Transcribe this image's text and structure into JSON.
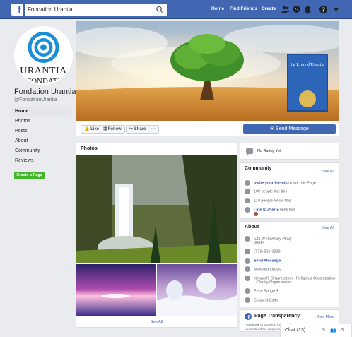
{
  "topbar": {
    "search_value": "Fondation Urantia",
    "nav": [
      "Home",
      "Find Friends",
      "Create"
    ],
    "icons": [
      "friends-icon",
      "messenger-icon",
      "notifications-icon",
      "help-icon",
      "caret-icon"
    ]
  },
  "profile": {
    "logo_text_top": "URANTIA",
    "logo_text_bottom": "FONDATI",
    "name": "Fondation Urantia",
    "handle": "@FondationUrantia"
  },
  "cover": {
    "book_title": "Le Livre d'Urantia"
  },
  "sidebar": {
    "items": [
      {
        "label": "Home",
        "active": true
      },
      {
        "label": "Photos",
        "active": false
      },
      {
        "label": "Posts",
        "active": false
      },
      {
        "label": "About",
        "active": false
      },
      {
        "label": "Community",
        "active": false
      },
      {
        "label": "Reviews",
        "active": false
      }
    ],
    "create_label": "Create a Page"
  },
  "actions": {
    "like": "Like",
    "follow": "Follow",
    "share": "Share",
    "more": "···",
    "send_message": "Send Message"
  },
  "photos": {
    "title": "Photos",
    "see_all": "See All"
  },
  "rating": {
    "text": "No Rating Yet"
  },
  "community": {
    "title": "Community",
    "see_all": "See All",
    "invite_link": "Invite your friends",
    "invite_rest": " to like this Page",
    "likes": "109 people like this",
    "follows": "119 people follow this",
    "friend_name": "Line St-Pierre",
    "friend_rest": " likes this"
  },
  "about": {
    "title": "About",
    "see_all": "See All",
    "address_line1": "533 W Diversey Pkwy",
    "address_line2": "60614",
    "phone": "(773) 525-3319",
    "send_message": "Send Message",
    "website": "www.urantia.org",
    "category_line1": "Nonprofit Organization · Religious Organization",
    "category_line2": "· Charity Organization",
    "price_range": "Price Range $",
    "suggest_edits": "Suggest Edits"
  },
  "transparency": {
    "title": "Page Transparency",
    "see_more": "See More",
    "text_line1": "Facebook is showing information to help you",
    "text_line2": "understand the purpose of a Page."
  },
  "chat": {
    "label": "Chat (13)"
  }
}
